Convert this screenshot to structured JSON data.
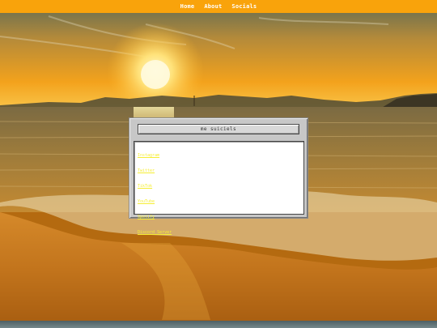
{
  "nav": {
    "links": [
      "Home",
      "About",
      "Socials"
    ]
  },
  "dialog": {
    "title": "me suiciels",
    "links": [
      "Instagram",
      "Twitter",
      "TikTok",
      "YouTube",
      "Spotify",
      "Discord Server"
    ]
  },
  "colors": {
    "nav_bar": "#f9a30b",
    "nav_text": "#ffffff",
    "window_face": "#c7c7c7",
    "link_text": "#f6ee34"
  }
}
